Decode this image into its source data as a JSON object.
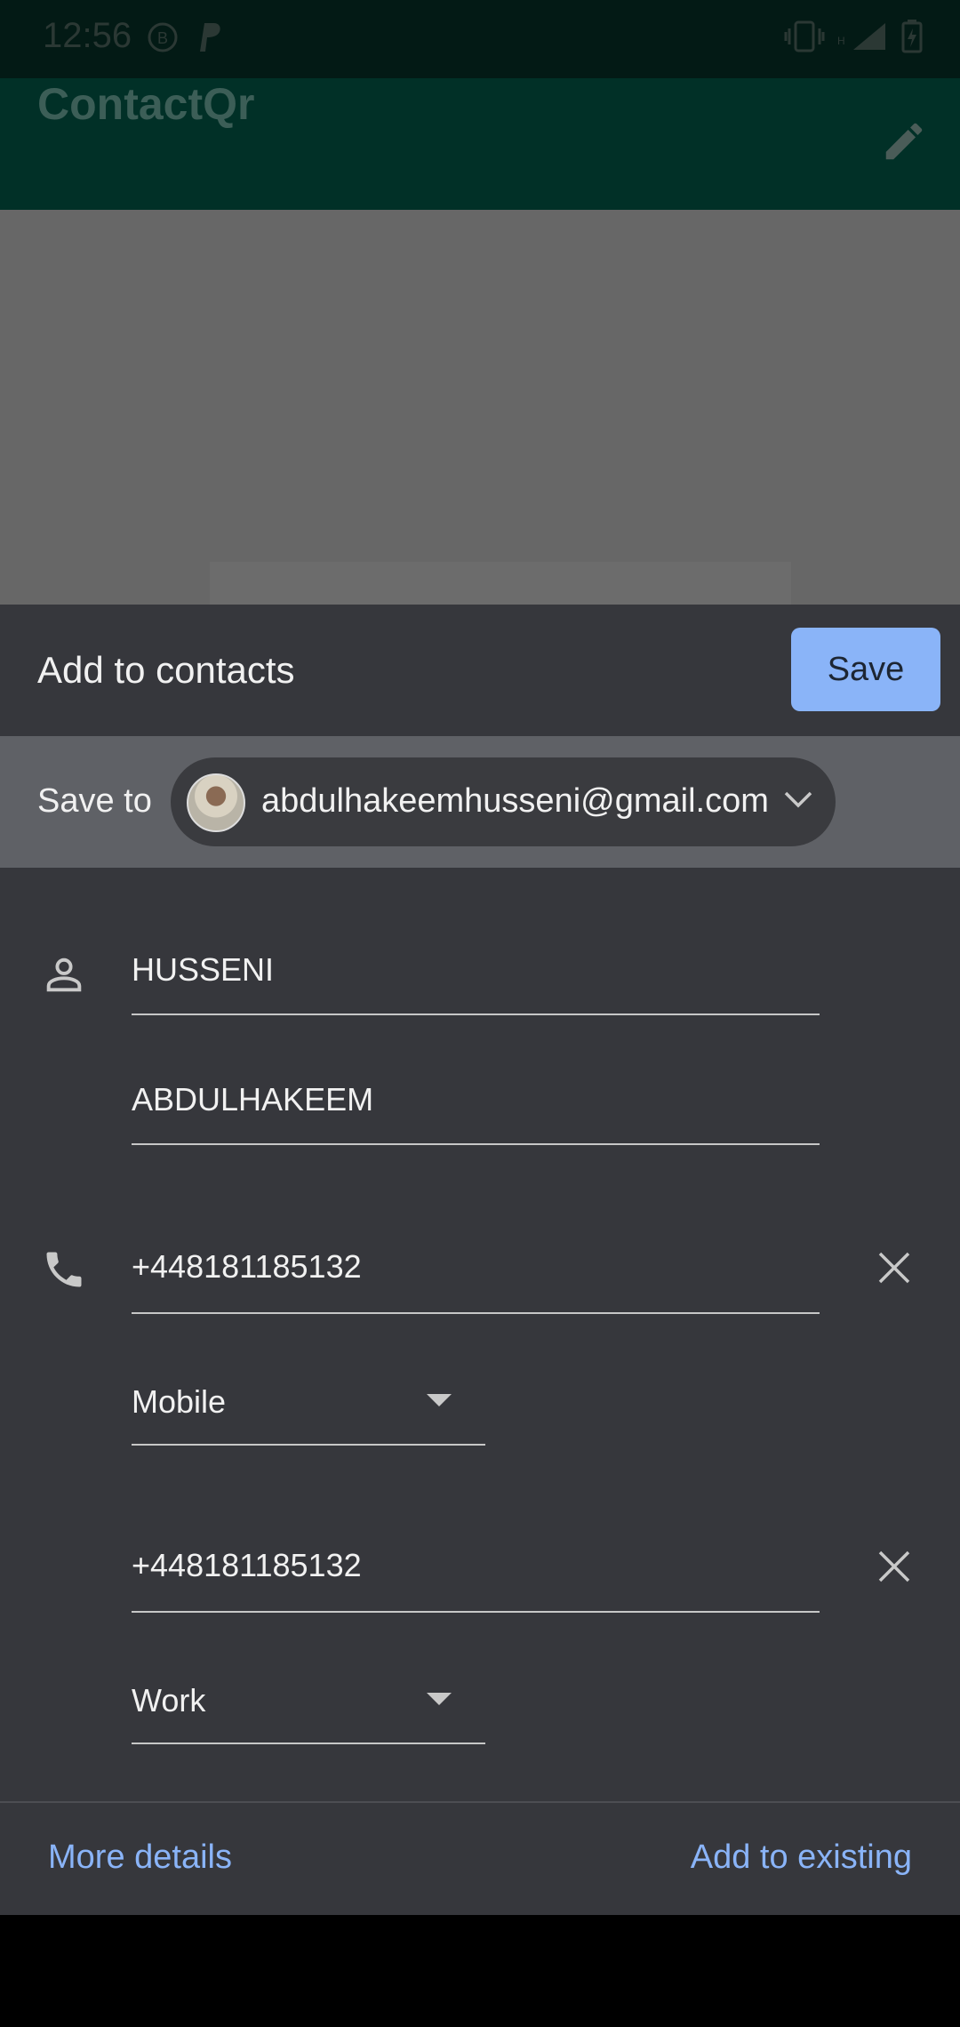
{
  "status_bar": {
    "time": "12:56"
  },
  "app_bar": {
    "title": "ContactQr"
  },
  "sheet": {
    "title": "Add to contacts",
    "save_label": "Save",
    "save_to_label": "Save to",
    "account_email": "abdulhakeemhusseni@gmail.com"
  },
  "form": {
    "name_first": "HUSSENI",
    "name_second": "ABDULHAKEEM",
    "phones": [
      {
        "number": "+448181185132",
        "type": "Mobile"
      },
      {
        "number": "+448181185132",
        "type": "Work"
      }
    ]
  },
  "footer": {
    "more_details": "More details",
    "add_to_existing": "Add to existing"
  },
  "colors": {
    "accent": "#8ab4f8",
    "sheet_bg": "#36373c",
    "app_bar": "#013027"
  }
}
